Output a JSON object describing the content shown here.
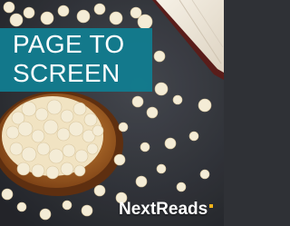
{
  "tile": {
    "title_line_1": "PAGE TO",
    "title_line_2": "SCREEN",
    "brand_name": "NextReads",
    "banner_color": "#127c8f",
    "brand_mark_color": "#f2b21a"
  }
}
